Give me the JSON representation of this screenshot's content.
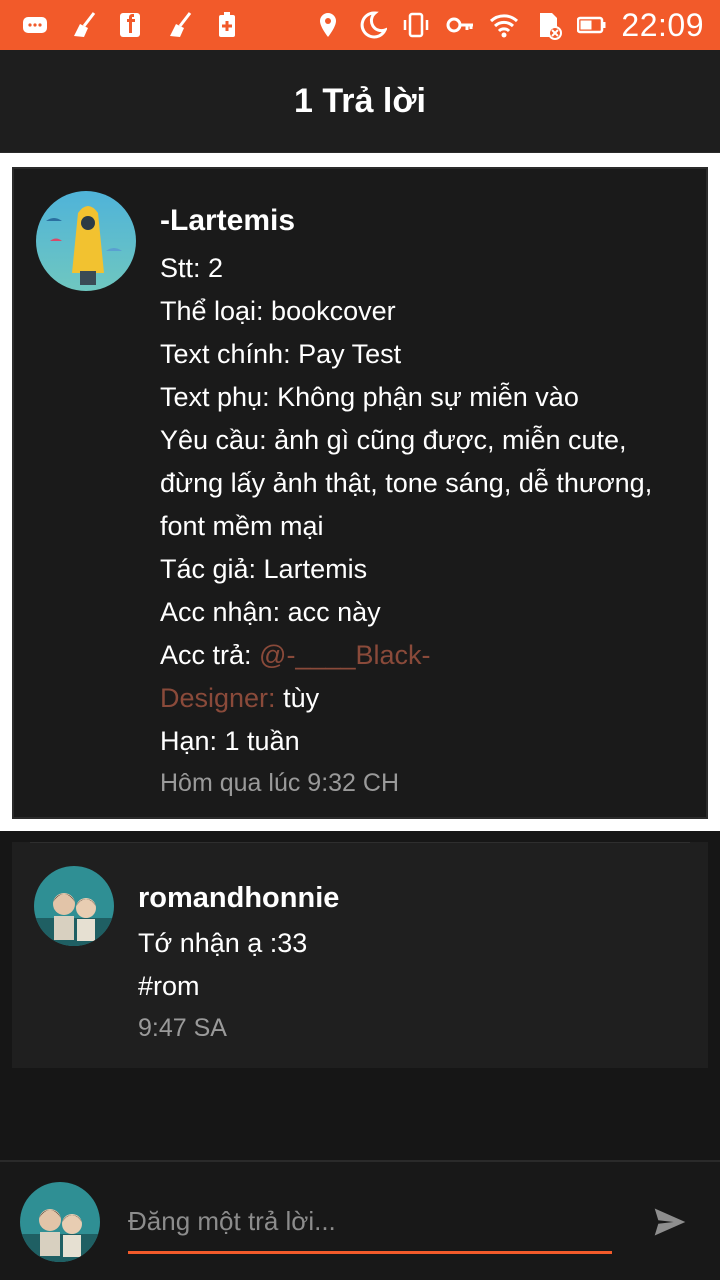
{
  "status_bar": {
    "time": "22:09",
    "accent_color": "#f25a2a",
    "left_icons": [
      "message-icon",
      "broom-icon",
      "facebook-icon",
      "broom-icon",
      "battery-plus-icon"
    ],
    "right_icons": [
      "location-icon",
      "moon-icon",
      "vibrate-icon",
      "key-icon",
      "wifi-icon",
      "sd-card-icon",
      "battery-icon"
    ]
  },
  "header": {
    "title": "1 Trả lời"
  },
  "post": {
    "author": "-Lartemis",
    "lines": {
      "stt": "Stt: 2",
      "the_loai": "Thể loại: bookcover",
      "text_chinh": "Text chính: Pay Test",
      "text_phu": "Text phụ: Không phận sự miễn vào",
      "yeu_cau_1": "Yêu cầu: ảnh gì cũng được, miễn cute,",
      "yeu_cau_2": "đừng lấy ảnh thật, tone sáng, dễ thương,",
      "yeu_cau_3": "font mềm mại",
      "tac_gia": "Tác giả: Lartemis",
      "acc_nhan": "Acc nhận: acc này",
      "acc_tra_label": "Acc trả: ",
      "acc_tra_mention_1": "@-____Black-",
      "acc_tra_mention_2": "Designer:",
      "acc_tra_suffix": " tùy",
      "han": "Hạn: 1 tuần"
    },
    "timestamp": "Hôm qua lúc 9:32 CH"
  },
  "reply": {
    "author": "romandhonnie",
    "line1": "Tớ nhận ạ :33",
    "line2": "#rom",
    "timestamp": "9:47 SA"
  },
  "composer": {
    "placeholder": "Đăng một trả lời...",
    "send_icon": "send-icon"
  }
}
